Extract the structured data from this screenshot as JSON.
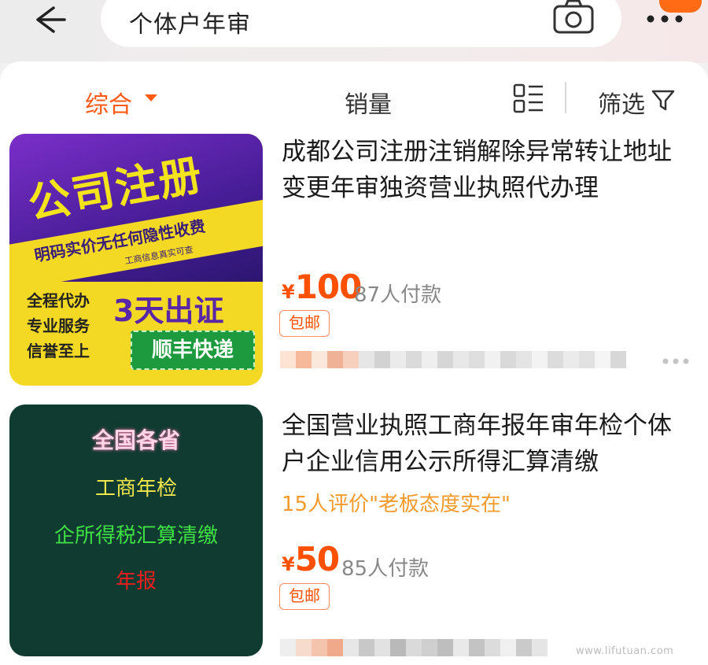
{
  "search": {
    "query": "个体户年审"
  },
  "sort_bar": {
    "comprehensive": "综合",
    "sales": "销量",
    "filter": "筛选"
  },
  "products": [
    {
      "title": "成都公司注册注销解除异常转让地址变更年审独资营业执照代办理",
      "currency": "¥",
      "price": "100",
      "paid": "87人付款",
      "tag": "包邮",
      "image_text": {
        "headline": "公司注册",
        "sub": "明码实价无任何隐性收费",
        "small": "工商信息真实可查",
        "left_lines": [
          "全程代办",
          "专业服务",
          "信誉至上"
        ],
        "badge": "3天出证",
        "delivery": "顺丰快递"
      }
    },
    {
      "title": "全国营业执照工商年报年审年检个体户企业信用公示所得汇算清缴",
      "review": "15人评价\"老板态度实在\"",
      "currency": "¥",
      "price": "50",
      "paid": "85人付款",
      "tag": "包邮",
      "image_text": {
        "line1": "全国各省",
        "line2": "工商年检",
        "line3": "企所得税汇算清缴",
        "line4": "年报"
      }
    }
  ],
  "watermark": "www.lifutuan.com",
  "colors": {
    "accent": "#ff5000",
    "review": "#f39a2c"
  }
}
